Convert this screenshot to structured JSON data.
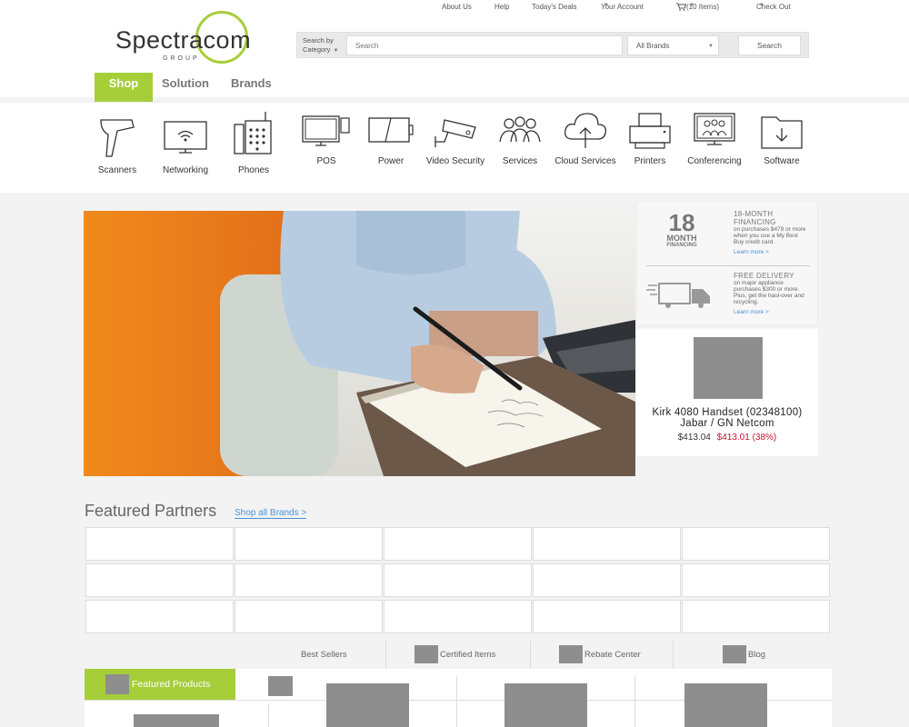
{
  "brand": {
    "logo_text": "Spectracom",
    "logo_subtext": "GROUP",
    "accent_color": "#a6ce39",
    "link_color": "#4a90d9",
    "sale_color": "#c8102e"
  },
  "top_links": {
    "about": "About Us",
    "help": "Help",
    "deals": "Today's Deals",
    "account": "Your Account",
    "cart": "(10 Items)",
    "checkout": "Check Out"
  },
  "search": {
    "category_label_1": "Search by",
    "category_label_2": "Category",
    "input_placeholder": "Search",
    "brand_select": "All Brands",
    "button": "Search"
  },
  "main_nav": {
    "shop": "Shop",
    "solution": "Solution",
    "brands": "Brands"
  },
  "categories": [
    {
      "label": "Scanners",
      "icon": "scanner-icon"
    },
    {
      "label": "Networking",
      "icon": "networking-icon"
    },
    {
      "label": "Phones",
      "icon": "phone-icon"
    },
    {
      "label": "POS",
      "icon": "pos-icon"
    },
    {
      "label": "Power",
      "icon": "power-icon"
    },
    {
      "label": "Video Security",
      "icon": "camera-icon"
    },
    {
      "label": "Services",
      "icon": "people-icon"
    },
    {
      "label": "Cloud Services",
      "icon": "cloud-icon"
    },
    {
      "label": "Printers",
      "icon": "printer-icon"
    },
    {
      "label": "Conferencing",
      "icon": "conference-icon"
    },
    {
      "label": "Software",
      "icon": "folder-icon"
    }
  ],
  "promo": {
    "financing_number": "18",
    "financing_unit": "MONTH",
    "financing_small": "FINANCING",
    "financing_title": "18-MONTH FINANCING",
    "financing_text": "on purchases $479 or more when you use a My Best Buy credit card.",
    "financing_link": "Learn more >",
    "delivery_title": "FREE DELIVERY",
    "delivery_text": "on major appliance purchases $300 or more. Plus, get the haul-over and recycling.",
    "delivery_link": "Learn more >"
  },
  "deal": {
    "name_line1": "Kirk 4080 Handset (02348100)",
    "name_line2": "Jabar / GN Netcom",
    "price": "$413.04",
    "sale_price": "$413.01 (38%)"
  },
  "featured_partners": {
    "title": "Featured Partners",
    "link": "Shop all Brands >"
  },
  "bottom_tabs": {
    "best_sellers": "Best Sellers",
    "certified": "Certified Items",
    "rebate": "Rebate Center",
    "blog": "Blog",
    "featured_products": "Featured Products"
  }
}
